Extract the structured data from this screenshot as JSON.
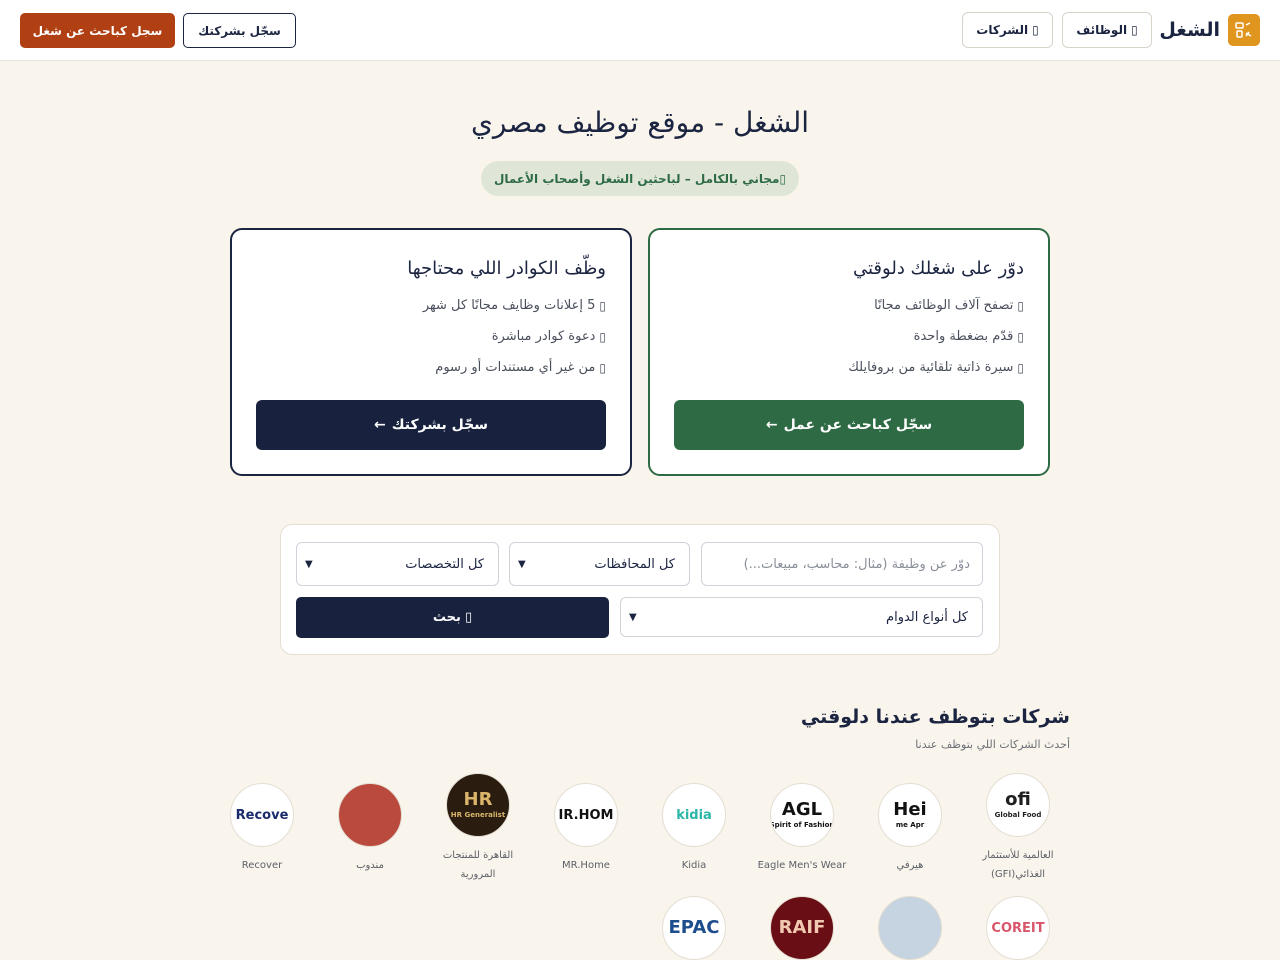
{
  "header": {
    "brand": "الشغل",
    "nav": [
      {
        "label": "الوظائف",
        "icon": "briefcase-icon"
      },
      {
        "label": "الشركات",
        "icon": "building-icon"
      }
    ],
    "register_company": "سجّل بشركتك",
    "register_seeker": "سجل كباحث عن شغل"
  },
  "hero": {
    "title": "الشغل - موقع توظيف مصري",
    "badge": "مجاني بالكامل – لباحثين الشغل وأصحاب الأعمال"
  },
  "cards": {
    "seeker": {
      "title": "دوّر على شغلك دلوقتي",
      "features": [
        "تصفح آلاف الوظائف مجانًا",
        "قدّم بضغطة واحدة",
        "سيرة ذاتية تلقائية من بروفايلك"
      ],
      "button": "سجّل كباحث عن عمل"
    },
    "employer": {
      "title": "وظّف الكوادر اللي محتاجها",
      "features": [
        "5 إعلانات وظايف مجانًا كل شهر",
        "دعوة كوادر مباشرة",
        "من غير أي مستندات أو رسوم"
      ],
      "button": "سجّل بشركتك"
    }
  },
  "search": {
    "placeholder": "دوّر عن وظيفة (مثال: محاسب، مبيعات...)",
    "governorate": "كل المحافظات",
    "specialty": "كل التخصصات",
    "job_type": "كل أنواع الدوام",
    "button": "بحث"
  },
  "companies": {
    "title": "شركات بتوظف عندنا دلوقتي",
    "subtitle": "أحدث الشركات اللي بتوظف عندنا",
    "row1": [
      {
        "name": "العالمية للأستثمار الغذائي(GFI)",
        "logo_text": "ofi",
        "logo_sub": "Global Food",
        "bg": "#ffffff",
        "fg": "#1f1f1f"
      },
      {
        "name": "هيرفي",
        "logo_text": "Hei",
        "logo_sub": "me Apr",
        "bg": "#ffffff",
        "fg": "#111111"
      },
      {
        "name": "Eagle Men's Wear",
        "logo_text": "AGL",
        "logo_sub": "Spirit of Fashion",
        "bg": "#ffffff",
        "fg": "#111111"
      },
      {
        "name": "Kidia",
        "logo_text": "kidia",
        "logo_sub": "",
        "bg": "#ffffff",
        "fg": "#2bb6a8"
      },
      {
        "name": "MR.Home",
        "logo_text": "IR.HOM",
        "logo_sub": "",
        "bg": "#ffffff",
        "fg": "#111111"
      },
      {
        "name": "القاهرة للمنتجات المرورية",
        "logo_text": "HR",
        "logo_sub": "HR Generalist",
        "bg": "#2a1d10",
        "fg": "#d9b46a"
      },
      {
        "name": "مندوب",
        "logo_text": "",
        "logo_sub": "",
        "bg": "#b94a3d",
        "fg": "#ffffff"
      },
      {
        "name": "Recover",
        "logo_text": "Recove",
        "logo_sub": "",
        "bg": "#ffffff",
        "fg": "#1a2a6c"
      }
    ],
    "row2": [
      {
        "name": "",
        "logo_text": "COREIT",
        "logo_sub": "",
        "bg": "#ffffff",
        "fg": "#d8566a"
      },
      {
        "name": "",
        "logo_text": "",
        "logo_sub": "",
        "bg": "#c6d3e1",
        "fg": "#2d4f86"
      },
      {
        "name": "",
        "logo_text": "RAIF",
        "logo_sub": "",
        "bg": "#6a0e16",
        "fg": "#f0c9b0"
      },
      {
        "name": "",
        "logo_text": "EPAC",
        "logo_sub": "",
        "bg": "#ffffff",
        "fg": "#1d4d8c"
      }
    ]
  }
}
